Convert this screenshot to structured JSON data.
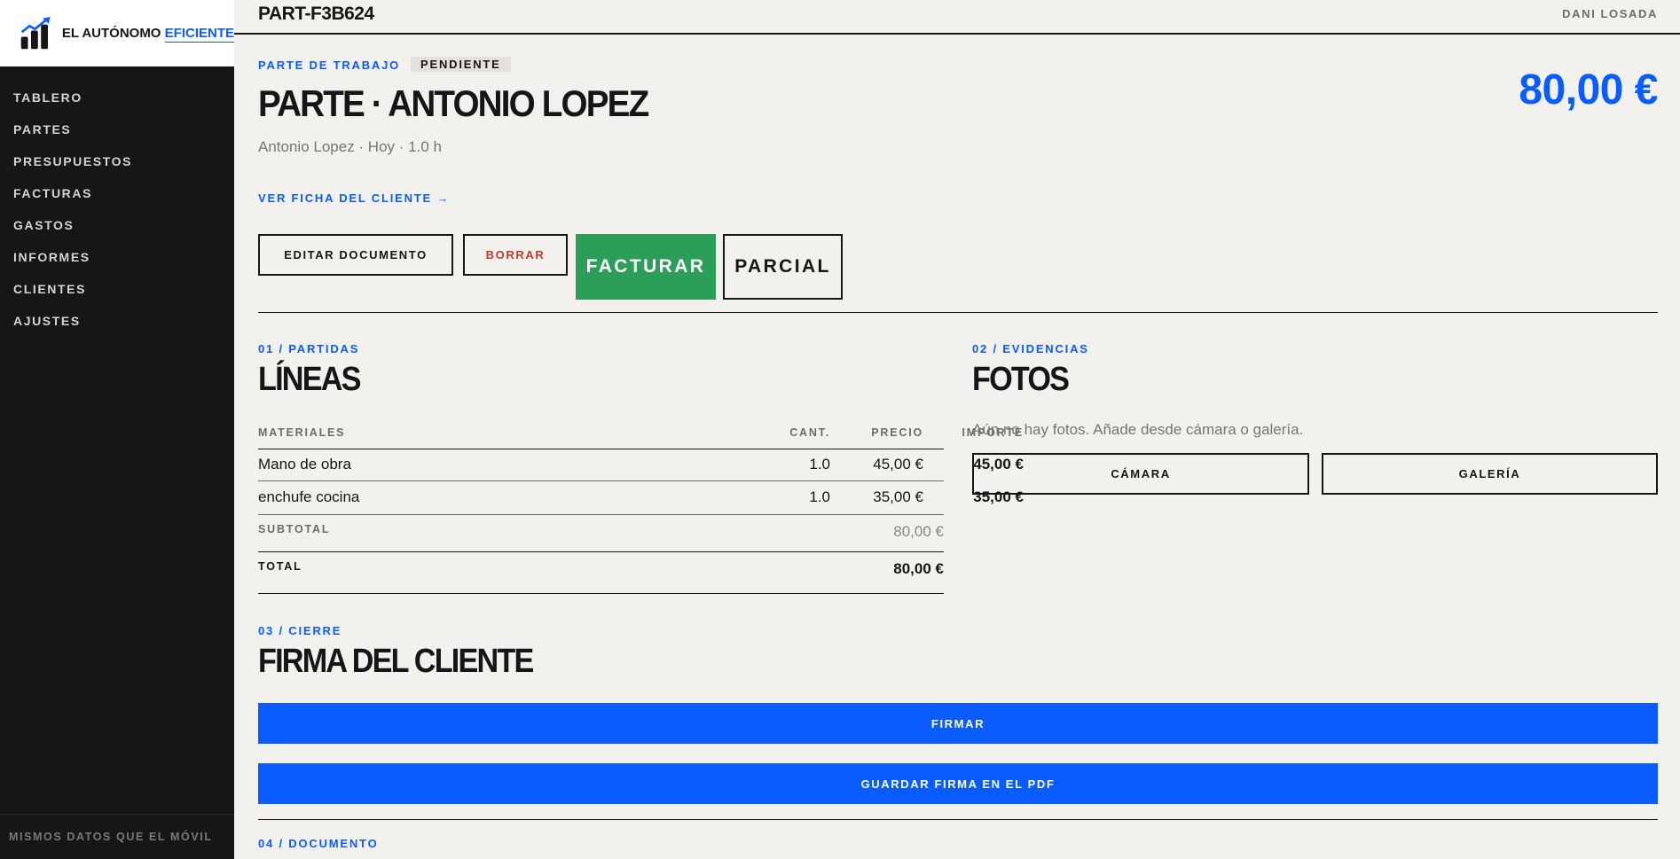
{
  "app": {
    "brand_primary": "EL AUTÓNOMO",
    "brand_accent": "EFICIENTE",
    "accent_color": "#0a5cff",
    "success_color": "#2d9e59",
    "danger_color": "#c23a2e"
  },
  "sidebar": {
    "items": [
      {
        "label": "TABLERO"
      },
      {
        "label": "PARTES"
      },
      {
        "label": "PRESUPUESTOS"
      },
      {
        "label": "FACTURAS"
      },
      {
        "label": "GASTOS"
      },
      {
        "label": "INFORMES"
      },
      {
        "label": "CLIENTES"
      },
      {
        "label": "AJUSTES"
      }
    ],
    "footer": "MISMOS DATOS QUE EL MÓVIL"
  },
  "topbar": {
    "doc_code": "PART-F3B624",
    "user": "DANI LOSADA"
  },
  "document": {
    "type_label": "PARTE DE TRABAJO",
    "status": "PENDIENTE",
    "title": "PARTE · ANTONIO LOPEZ",
    "subtitle": "Antonio Lopez · Hoy · 1.0 h",
    "amount": "80,00 €",
    "client_link": "VER FICHA DEL CLIENTE →"
  },
  "actions": {
    "edit": "EDITAR DOCUMENTO",
    "delete": "BORRAR",
    "invoice": "FACTURAR",
    "partial": "PARCIAL"
  },
  "lines_section": {
    "eyebrow": "01 / PARTIDAS",
    "title": "LÍNEAS",
    "columns": {
      "materials": "MATERIALES",
      "qty": "CANT.",
      "price": "PRECIO",
      "amount": "IMPORTE"
    },
    "rows": [
      {
        "description": "Mano de obra",
        "qty": "1.0",
        "price": "45,00 €",
        "amount": "45,00 €"
      },
      {
        "description": "enchufe cocina",
        "qty": "1.0",
        "price": "35,00 €",
        "amount": "35,00 €"
      }
    ],
    "subtotal_label": "SUBTOTAL",
    "subtotal": "80,00 €",
    "total_label": "TOTAL",
    "total": "80,00 €"
  },
  "photos_section": {
    "eyebrow": "02 / EVIDENCIAS",
    "title": "FOTOS",
    "empty_text": "Aún no hay fotos. Añade desde cámara o galería.",
    "camera": "CÁMARA",
    "gallery": "GALERÍA"
  },
  "signature_section": {
    "eyebrow": "03 / CIERRE",
    "title": "FIRMA DEL CLIENTE",
    "sign": "FIRMAR",
    "save_sign": "GUARDAR FIRMA EN EL PDF"
  },
  "document_section": {
    "eyebrow": "04 / DOCUMENTO"
  }
}
